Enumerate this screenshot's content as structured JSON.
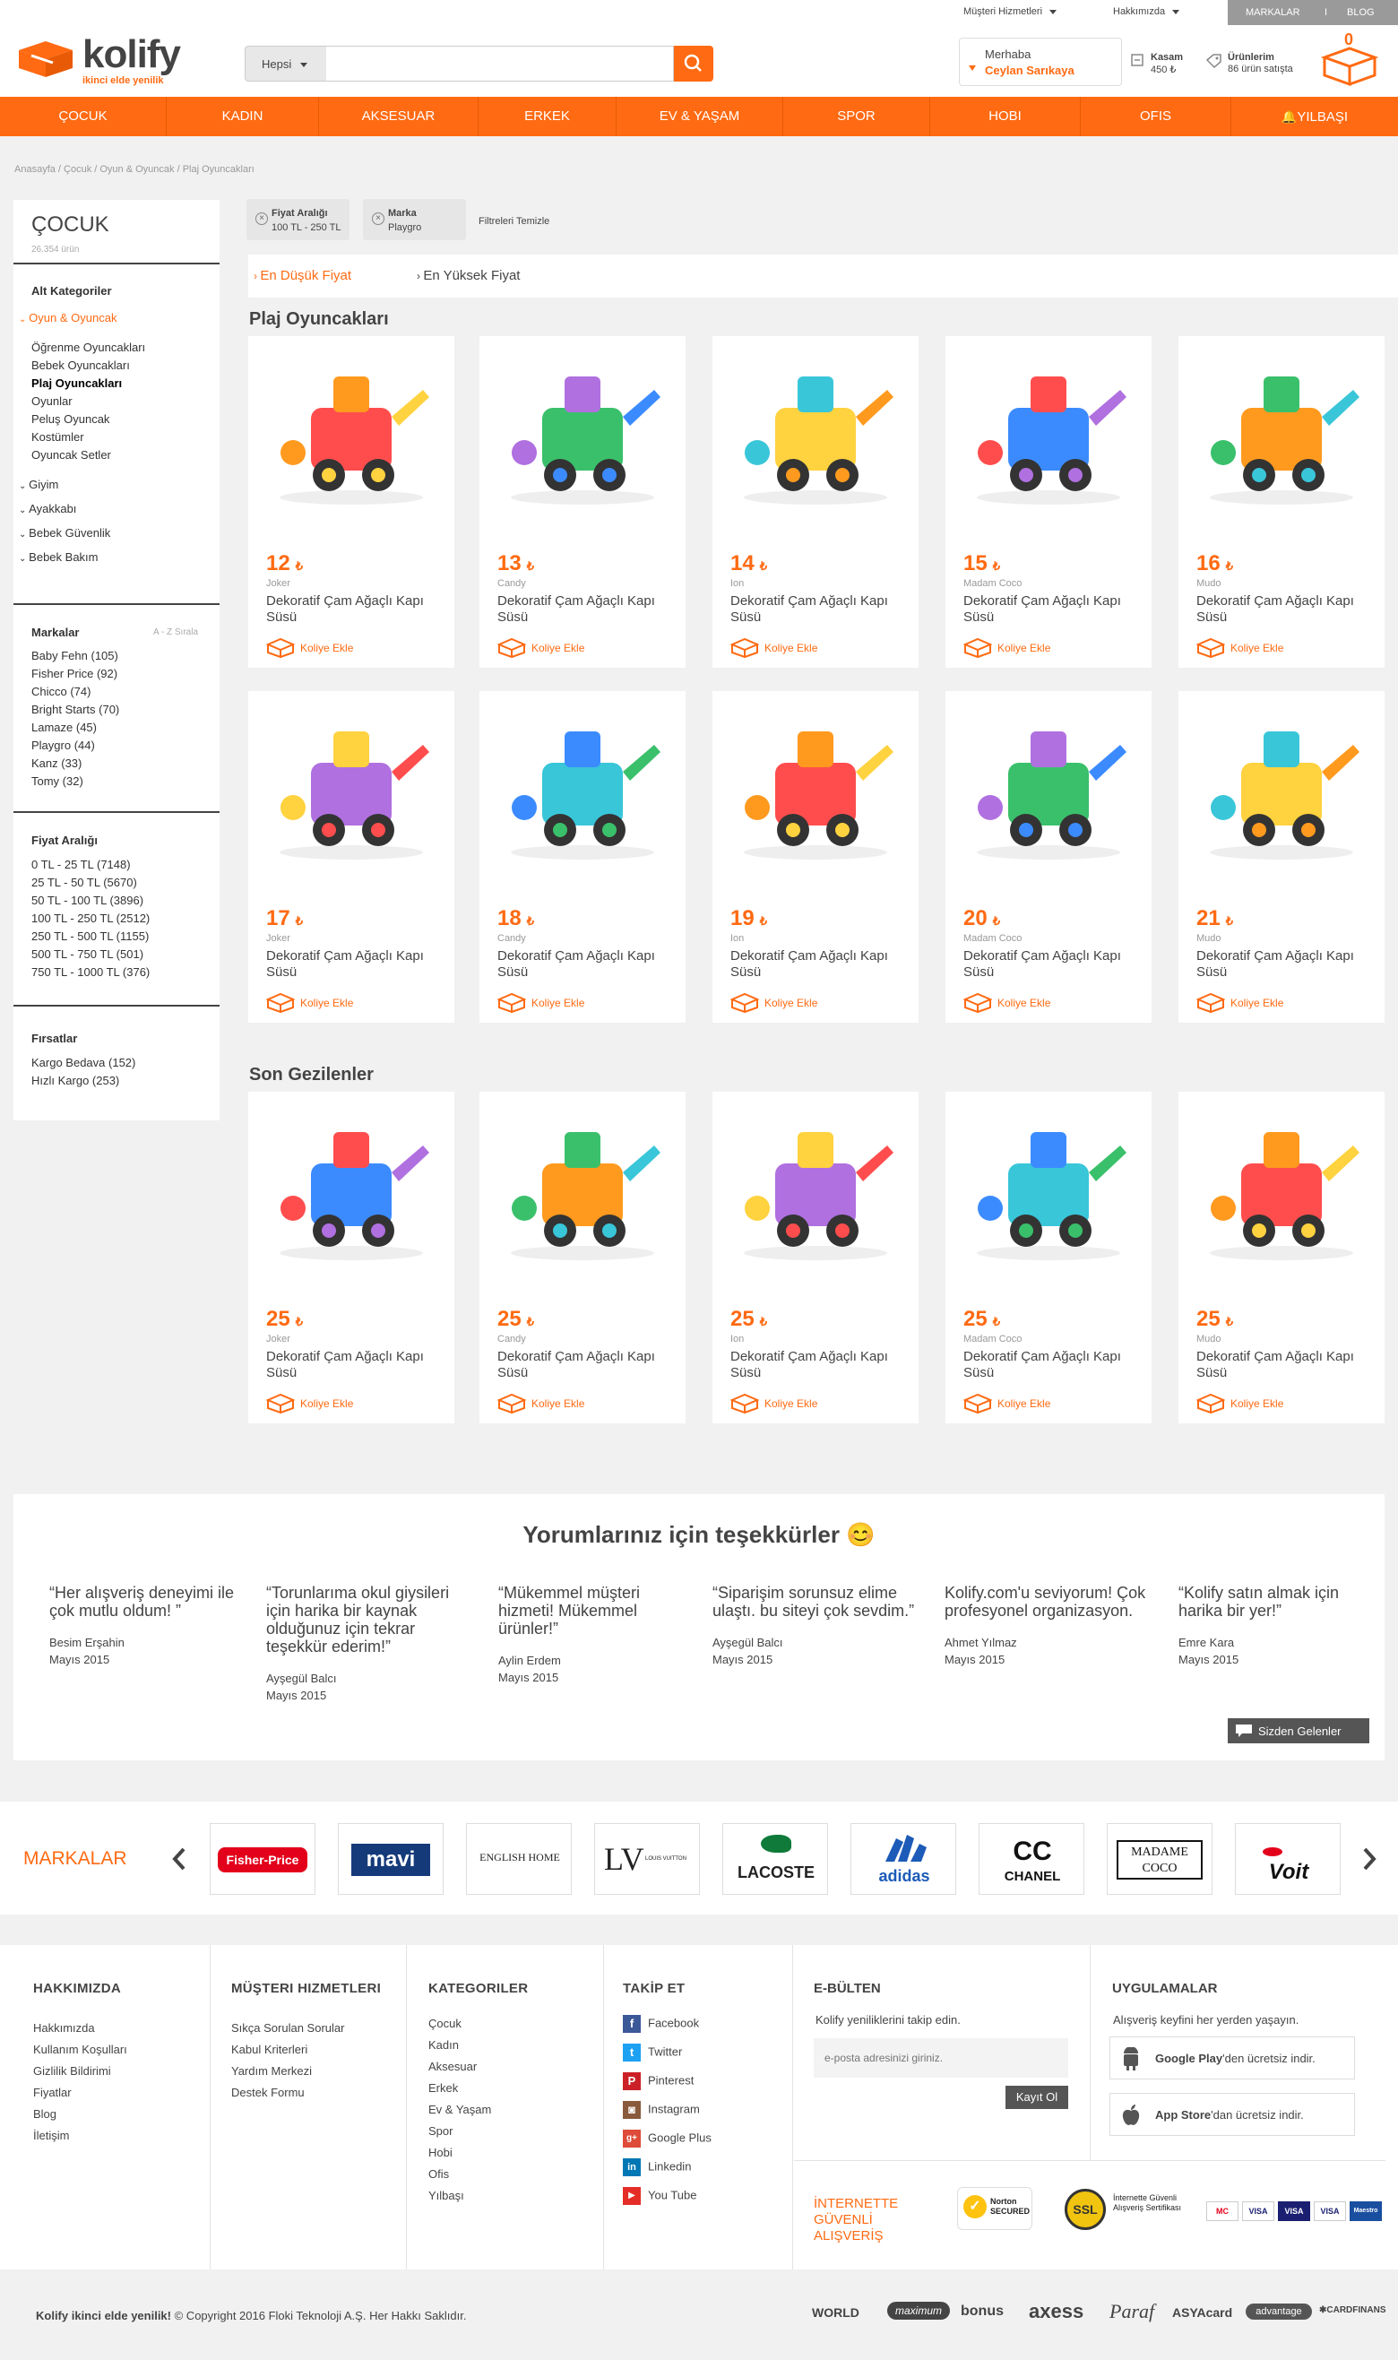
{
  "topbar": {
    "customer_service": "Müşteri Hizmetleri",
    "about": "Hakkımızda",
    "brands": "MARKALAR",
    "sep": "I",
    "blog": "BLOG"
  },
  "header": {
    "logo": "kolify",
    "tagline": "ikinci elde yenilik",
    "search": {
      "category": "Hepsi",
      "placeholder": ""
    },
    "user": {
      "greeting": "Merhaba",
      "name": "Ceylan Sarıkaya"
    },
    "wallet": {
      "label": "Kasam",
      "value": "450 ₺"
    },
    "products": {
      "label": "Ürünlerim",
      "value": "86 ürün satışta"
    },
    "cart_count": "0"
  },
  "nav": [
    "ÇOCUK",
    "KADIN",
    "AKSESUAR",
    "ERKEK",
    "EV & YAŞAM",
    "SPOR",
    "HOBI",
    "OFIS",
    "YILBAŞI"
  ],
  "breadcrumb": "Anasayfa  /  Çocuk  /  Oyun & Oyuncak  /  Plaj Oyuncakları",
  "sidebar": {
    "title": "ÇOCUK",
    "count": "26.354 ürün",
    "subcats_title": "Alt Kategoriler",
    "active_parent": "Oyun & Oyuncak",
    "subcats": [
      "Öğrenme Oyuncakları",
      "Bebek Oyuncakları",
      "Plaj Oyuncakları",
      "Oyunlar",
      "Peluş Oyuncak",
      "Kostümler",
      "Oyuncak Setler"
    ],
    "parents": [
      "Giyim",
      "Ayakkabı",
      "Bebek Güvenlik",
      "Bebek Bakım"
    ],
    "brands_title": "Markalar",
    "brands_sort": "A - Z Sırala",
    "brands": [
      "Baby Fehn (105)",
      "Fisher Price (92)",
      "Chicco (74)",
      "Bright Starts (70)",
      "Lamaze (45)",
      "Playgro (44)",
      "Kanz (33)",
      "Tomy (32)"
    ],
    "price_title": "Fiyat Aralığı",
    "prices": [
      "0 TL - 25 TL (7148)",
      "25 TL - 50 TL (5670)",
      "50 TL - 100 TL (3896)",
      "100 TL - 250 TL (2512)",
      "250 TL - 500 TL (1155)",
      "500 TL - 750 TL (501)",
      "750 TL - 1000 TL (376)"
    ],
    "deals_title": "Fırsatlar",
    "deals": [
      "Kargo Bedava (152)",
      "Hızlı Kargo (253)"
    ]
  },
  "filters": [
    {
      "title": "Fiyat Aralığı",
      "value": "100 TL - 250 TL"
    },
    {
      "title": "Marka",
      "value": "Playgro"
    }
  ],
  "clear_filters": "Filtreleri Temizle",
  "sort": {
    "low": "En Düşük Fiyat",
    "high": "En Yüksek Fiyat"
  },
  "section1": "Plaj Oyuncakları",
  "section2": "Son Gezilenler",
  "add_label": "Koliye Ekle",
  "currency": "₺",
  "products": [
    {
      "price": "12",
      "brand": "Joker",
      "name": "Dekoratif Çam Ağaçlı Kapı Süsü"
    },
    {
      "price": "13",
      "brand": "Candy",
      "name": "Dekoratif Çam Ağaçlı Kapı Süsü"
    },
    {
      "price": "14",
      "brand": "Ion",
      "name": "Dekoratif Çam Ağaçlı Kapı Süsü"
    },
    {
      "price": "15",
      "brand": "Madam Coco",
      "name": "Dekoratif Çam Ağaçlı Kapı Süsü"
    },
    {
      "price": "16",
      "brand": "Mudo",
      "name": "Dekoratif Çam Ağaçlı Kapı Süsü"
    },
    {
      "price": "17",
      "brand": "Joker",
      "name": "Dekoratif Çam Ağaçlı Kapı Süsü"
    },
    {
      "price": "18",
      "brand": "Candy",
      "name": "Dekoratif Çam Ağaçlı Kapı Süsü"
    },
    {
      "price": "19",
      "brand": "Ion",
      "name": "Dekoratif Çam Ağaçlı Kapı Süsü"
    },
    {
      "price": "20",
      "brand": "Madam Coco",
      "name": "Dekoratif Çam Ağaçlı Kapı Süsü"
    },
    {
      "price": "21",
      "brand": "Mudo",
      "name": "Dekoratif Çam Ağaçlı Kapı Süsü"
    }
  ],
  "recent": [
    {
      "price": "25",
      "brand": "Joker",
      "name": "Dekoratif Çam Ağaçlı Kapı Süsü"
    },
    {
      "price": "25",
      "brand": "Candy",
      "name": "Dekoratif Çam Ağaçlı Kapı Süsü"
    },
    {
      "price": "25",
      "brand": "Ion",
      "name": "Dekoratif Çam Ağaçlı Kapı Süsü"
    },
    {
      "price": "25",
      "brand": "Madam Coco",
      "name": "Dekoratif Çam Ağaçlı Kapı Süsü"
    },
    {
      "price": "25",
      "brand": "Mudo",
      "name": "Dekoratif Çam Ağaçlı Kapı Süsü"
    }
  ],
  "reviews": {
    "title": "Yorumlarınız için teşekkürler 😊",
    "items": [
      {
        "quote": "“Her alışveriş deneyimi ile çok mutlu oldum! ”",
        "author": "Besim Erşahin",
        "date": "Mayıs 2015"
      },
      {
        "quote": "“Torunlarıma okul giysileri için harika bir kaynak olduğunuz için tekrar teşekkür ederim!”",
        "author": "Ayşegül Balcı",
        "date": "Mayıs 2015"
      },
      {
        "quote": "“Mükemmel müşteri hizmeti! Mükemmel ürünler!”",
        "author": "Aylin Erdem",
        "date": "Mayıs 2015"
      },
      {
        "quote": "“Siparişim sorunsuz elime ulaştı. bu siteyi çok sevdim.”",
        "author": "Ayşegül Balcı",
        "date": "Mayıs 2015"
      },
      {
        "quote": "Kolify.com'u seviyorum! Çok profesyonel organizasyon.",
        "author": "Ahmet Yılmaz",
        "date": "Mayıs 2015"
      },
      {
        "quote": "“Kolify satın almak için harika bir yer!”",
        "author": "Emre Kara",
        "date": "Mayıs 2015"
      }
    ],
    "button": "Sizden Gelenler"
  },
  "brands_bar": {
    "title": "MARKALAR",
    "logos": [
      "Fisher-Price",
      "mavi",
      "ENGLISH HOME",
      "LOUIS VUITTON",
      "LACOSTE",
      "adidas",
      "CHANEL",
      "MADAME COCO",
      "Voit"
    ]
  },
  "footer": {
    "about_title": "HAKKIMIZDA",
    "about": [
      "Hakkımızda",
      "Kullanım Koşulları",
      "Gizlilik Bildirimi",
      "Fiyatlar",
      "Blog",
      "İletişim"
    ],
    "service_title": "MÜŞTERI HIZMETLERI",
    "service": [
      "Sıkça Sorulan Sorular",
      "Kabul Kriterleri",
      "Yardım Merkezi",
      "Destek Formu"
    ],
    "cats_title": "KATEGORILER",
    "cats": [
      "Çocuk",
      "Kadın",
      "Aksesuar",
      "Erkek",
      "Ev & Yaşam",
      "Spor",
      "Hobi",
      "Ofis",
      "Yılbaşı"
    ],
    "follow_title": "TAKİP ET",
    "follow": [
      "Facebook",
      "Twitter",
      "Pinterest",
      "Instagram",
      "Google Plus",
      "Linkedin",
      "You Tube"
    ],
    "newsletter_title": "E-BÜLTEN",
    "newsletter_text": "Kolify yeniliklerini takip edin.",
    "newsletter_placeholder": "e-posta adresinizi giriniz.",
    "newsletter_button": "Kayıt Ol",
    "apps_title": "UYGULAMALAR",
    "apps_text": "Alışveriş keyfini her yerden yaşayın.",
    "gplay_bold": "Google Play",
    "gplay_rest": "'den ücretsiz indir.",
    "appstore_bold": "App Store",
    "appstore_rest": "'dan ücretsiz indir.",
    "secure_text": "İNTERNETTE GÜVENLİ ALIŞVERİŞ",
    "norton": "Norton SECURED",
    "ssl_text": "İnternette Güvenli Alışveriş Sertifikası",
    "cards": [
      "MC",
      "VISA",
      "VISA",
      "VISA",
      "Maestro"
    ]
  },
  "bottom": {
    "brand": "Kolify ikinci elde yenilik!",
    "copy": " © Copyright 2016 Floki Teknoloji A.Ş. Her Hakkı Saklıdır.",
    "banks": [
      "WORLD",
      "maximum",
      "bonus",
      "axess",
      "Paraf",
      "ASYAcard",
      "advantage",
      "CARDFINANS"
    ]
  },
  "colors": {
    "accent": "#ff6a12",
    "text": "#444444",
    "bg": "#f1f1f1"
  }
}
